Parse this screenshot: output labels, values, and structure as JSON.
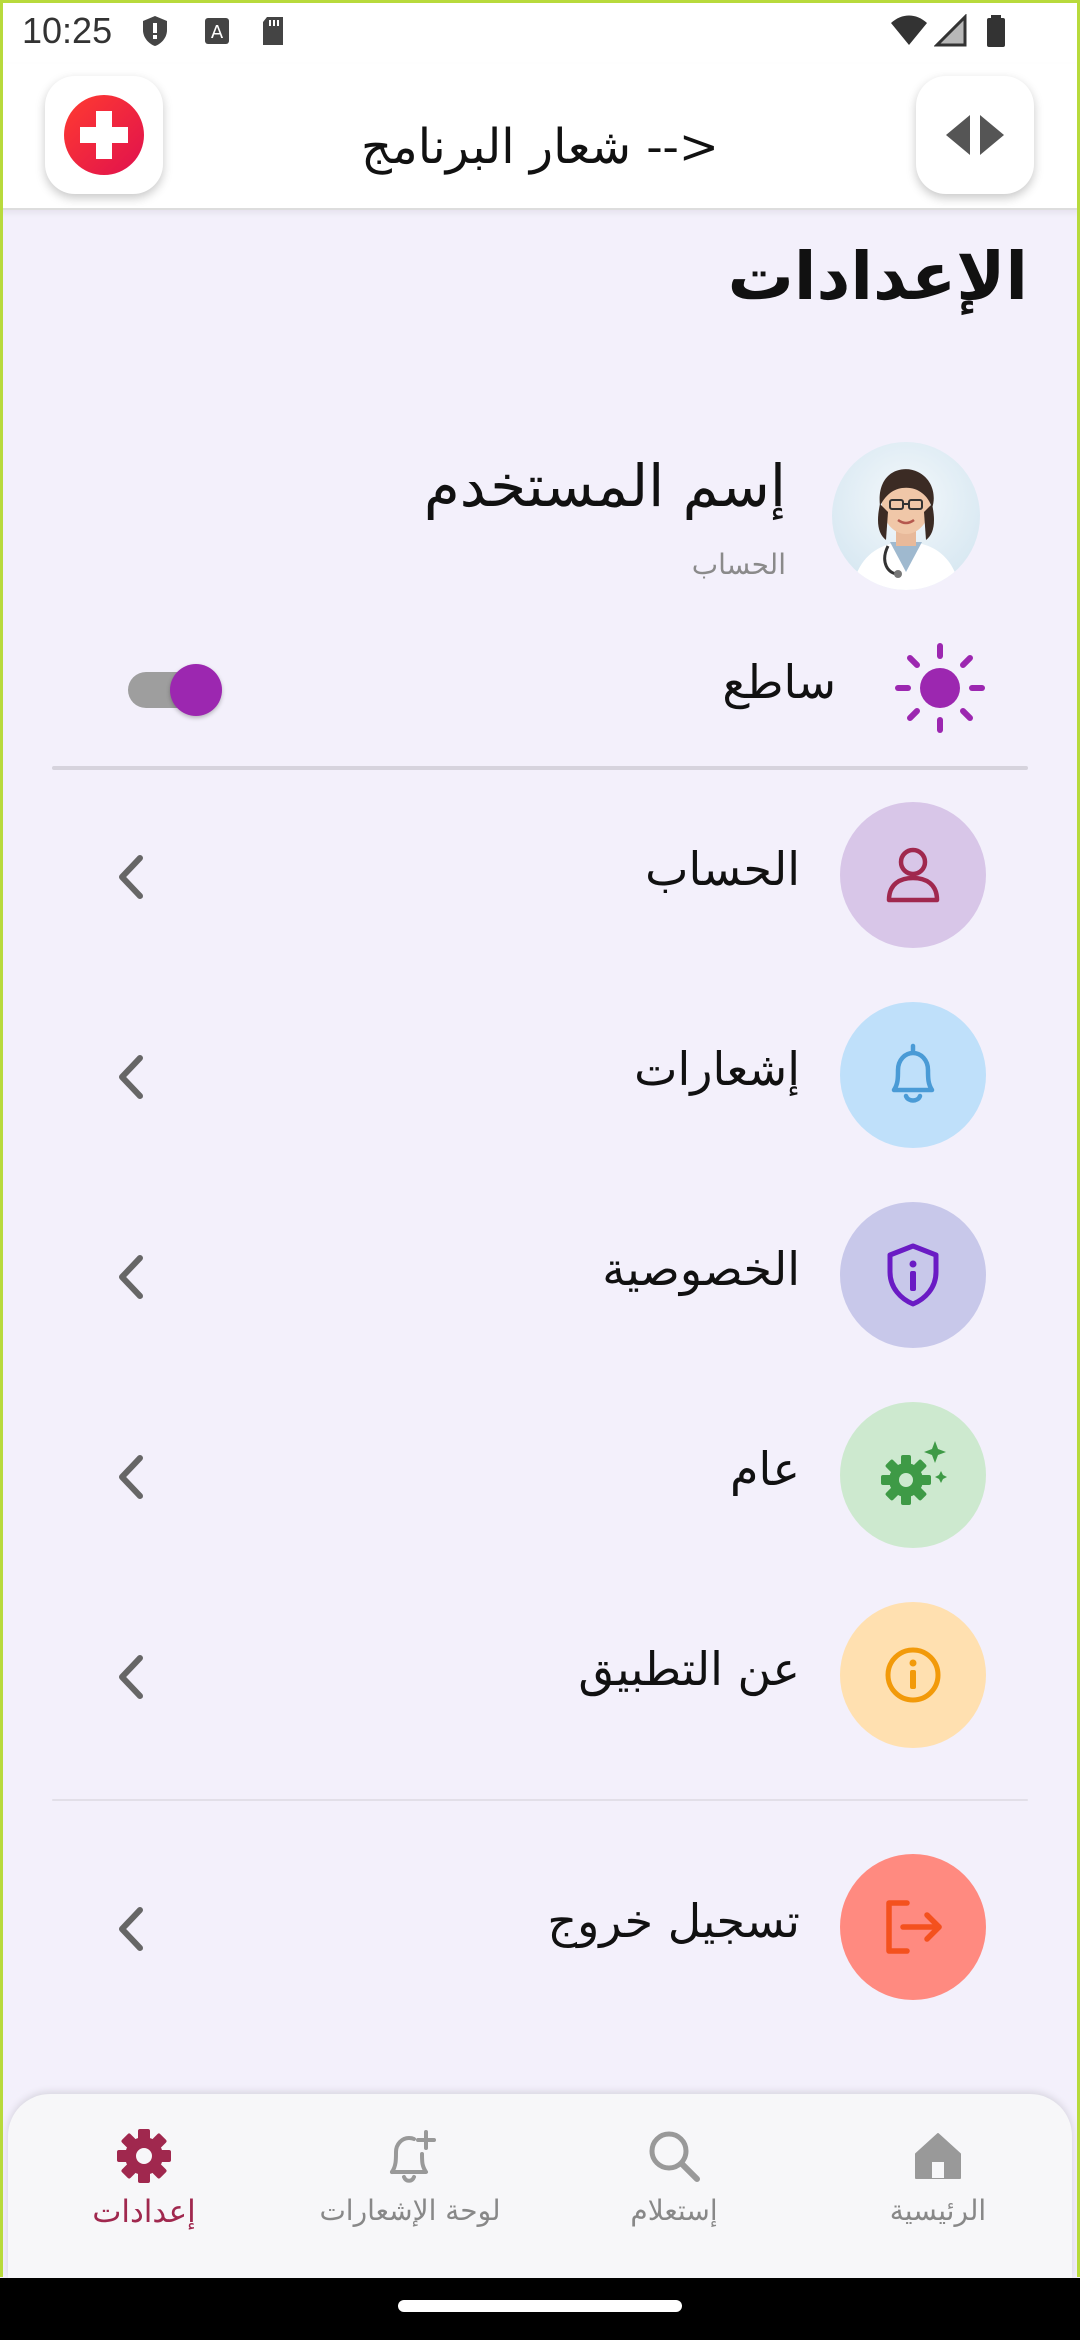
{
  "status_bar": {
    "time": "10:25"
  },
  "app_bar": {
    "title": "شعار البرنامج -->"
  },
  "page": {
    "title": "الإعدادات"
  },
  "profile": {
    "name": "إسم المستخدم",
    "subtitle": "الحساب"
  },
  "theme": {
    "label": "ساطع",
    "toggle_on": true
  },
  "menu": [
    {
      "label": "الحساب",
      "icon": "user-icon",
      "bg": "#D8C6E8",
      "fg": "#A0284E"
    },
    {
      "label": "إشعارات",
      "icon": "bell-icon",
      "bg": "#BFE0FA",
      "fg": "#4A9BD6"
    },
    {
      "label": "الخصوصية",
      "icon": "shield-info-icon",
      "bg": "#C8C8EA",
      "fg": "#6A1BC4"
    },
    {
      "label": "عام",
      "icon": "gear-sparkle-icon",
      "bg": "#CDE9CF",
      "fg": "#3E9A46"
    },
    {
      "label": "عن التطبيق",
      "icon": "info-icon",
      "bg": "#FFE0B0",
      "fg": "#F29A0A"
    }
  ],
  "logout": {
    "label": "تسجيل خروج",
    "icon": "logout-icon",
    "bg": "#FF8A80",
    "fg": "#F4511E"
  },
  "bottom_nav": [
    {
      "label": "إعدادات",
      "icon": "gear-icon",
      "active": true
    },
    {
      "label": "لوحة الإشعارات",
      "icon": "bell-plus-icon",
      "active": false
    },
    {
      "label": "إستعلام",
      "icon": "search-icon",
      "active": false
    },
    {
      "label": "الرئيسية",
      "icon": "home-icon",
      "active": false
    }
  ],
  "colors": {
    "accent": "#A0284E",
    "toggle": "#9C27B0",
    "background": "#F3F0FB"
  }
}
